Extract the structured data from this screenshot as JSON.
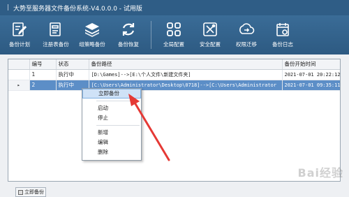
{
  "window": {
    "title": "大势至服务器文件备份系统-V4.0.0.0 - 试用版"
  },
  "toolbar": {
    "items": [
      {
        "label": "备份计划",
        "icon": "edit-plan-icon"
      },
      {
        "label": "注册表备份",
        "icon": "registry-icon"
      },
      {
        "label": "组策略备份",
        "icon": "layers-icon"
      },
      {
        "label": "备份恢复",
        "icon": "restore-icon"
      },
      {
        "label": "全局配置",
        "icon": "grid-settings-icon"
      },
      {
        "label": "安全配置",
        "icon": "security-tools-icon"
      },
      {
        "label": "权限迁移",
        "icon": "migrate-icon"
      },
      {
        "label": "备份日志",
        "icon": "calendar-log-icon"
      }
    ]
  },
  "grid": {
    "columns": [
      "编号",
      "状态",
      "备份路径",
      "备份开始时间"
    ],
    "rows": [
      {
        "id": "1",
        "status": "执行中",
        "path": "[D:\\Games]-->[E:\\个人文件\\新建文件夹]",
        "time": "2021-07-01 20:22:12"
      },
      {
        "id": "2",
        "status": "执行中",
        "path": "[C:\\Users\\Administrator\\Desktop\\0718]-->[C:\\Users\\Administrator",
        "time": "2021-07-01 09:35:11"
      }
    ]
  },
  "context_menu": {
    "items": [
      "立即备份",
      "启动",
      "停止",
      "新增",
      "编辑",
      "删除"
    ]
  },
  "bottom": {
    "backup_now_label": "立即备份"
  },
  "watermark": "Bai经验",
  "colors": {
    "toolbar": "#3a6c97",
    "selection": "#5c8ec7",
    "arrow": "#e53935"
  }
}
